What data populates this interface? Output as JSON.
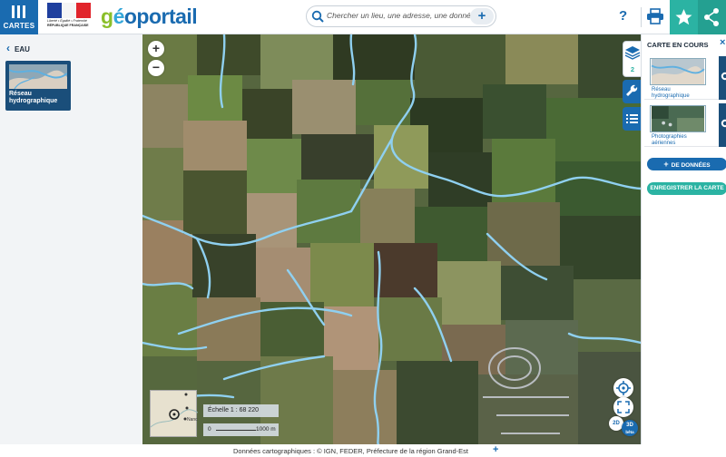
{
  "header": {
    "menu_label": "CARTES",
    "republic": {
      "line1": "Liberté • Égalité • Fraternité",
      "line2": "RÉPUBLIQUE FRANÇAISE"
    },
    "brand": {
      "g": "g",
      "e": "é",
      "o": "o",
      "rest": "portail"
    },
    "search": {
      "placeholder": "Chercher un lieu, une adresse, une donnée"
    },
    "help_label": "?",
    "colors": {
      "primary": "#1a6bb0",
      "accent": "#2bb3a3",
      "brand_green": "#8bbf2a"
    }
  },
  "left_panel": {
    "back_label": "EAU",
    "card_title": "Réseau hydrographique"
  },
  "map": {
    "zoom_in": "+",
    "zoom_out": "−",
    "overview_place": "Nanc",
    "scale_text": "Échelle 1 : 68 220",
    "scale_zero": "0",
    "scale_distance": "1000 m",
    "layer_count": "2",
    "view_2d": "2D",
    "view_3d": "3D",
    "view_3d_badge": "bêta"
  },
  "right_panel": {
    "title": "CARTE EN COURS",
    "close": "×",
    "layers": [
      {
        "name": "Réseau hydrographique"
      },
      {
        "name": "Photographies aériennes"
      }
    ],
    "add_data_label": "DE DONNÉES",
    "add_data_plus": "+",
    "save_label": "ENREGISTRER LA CARTE"
  },
  "footer": {
    "attribution": "Données cartographiques : © IGN, FEDER, Préfecture de la région Grand-Est",
    "expand": "+"
  }
}
